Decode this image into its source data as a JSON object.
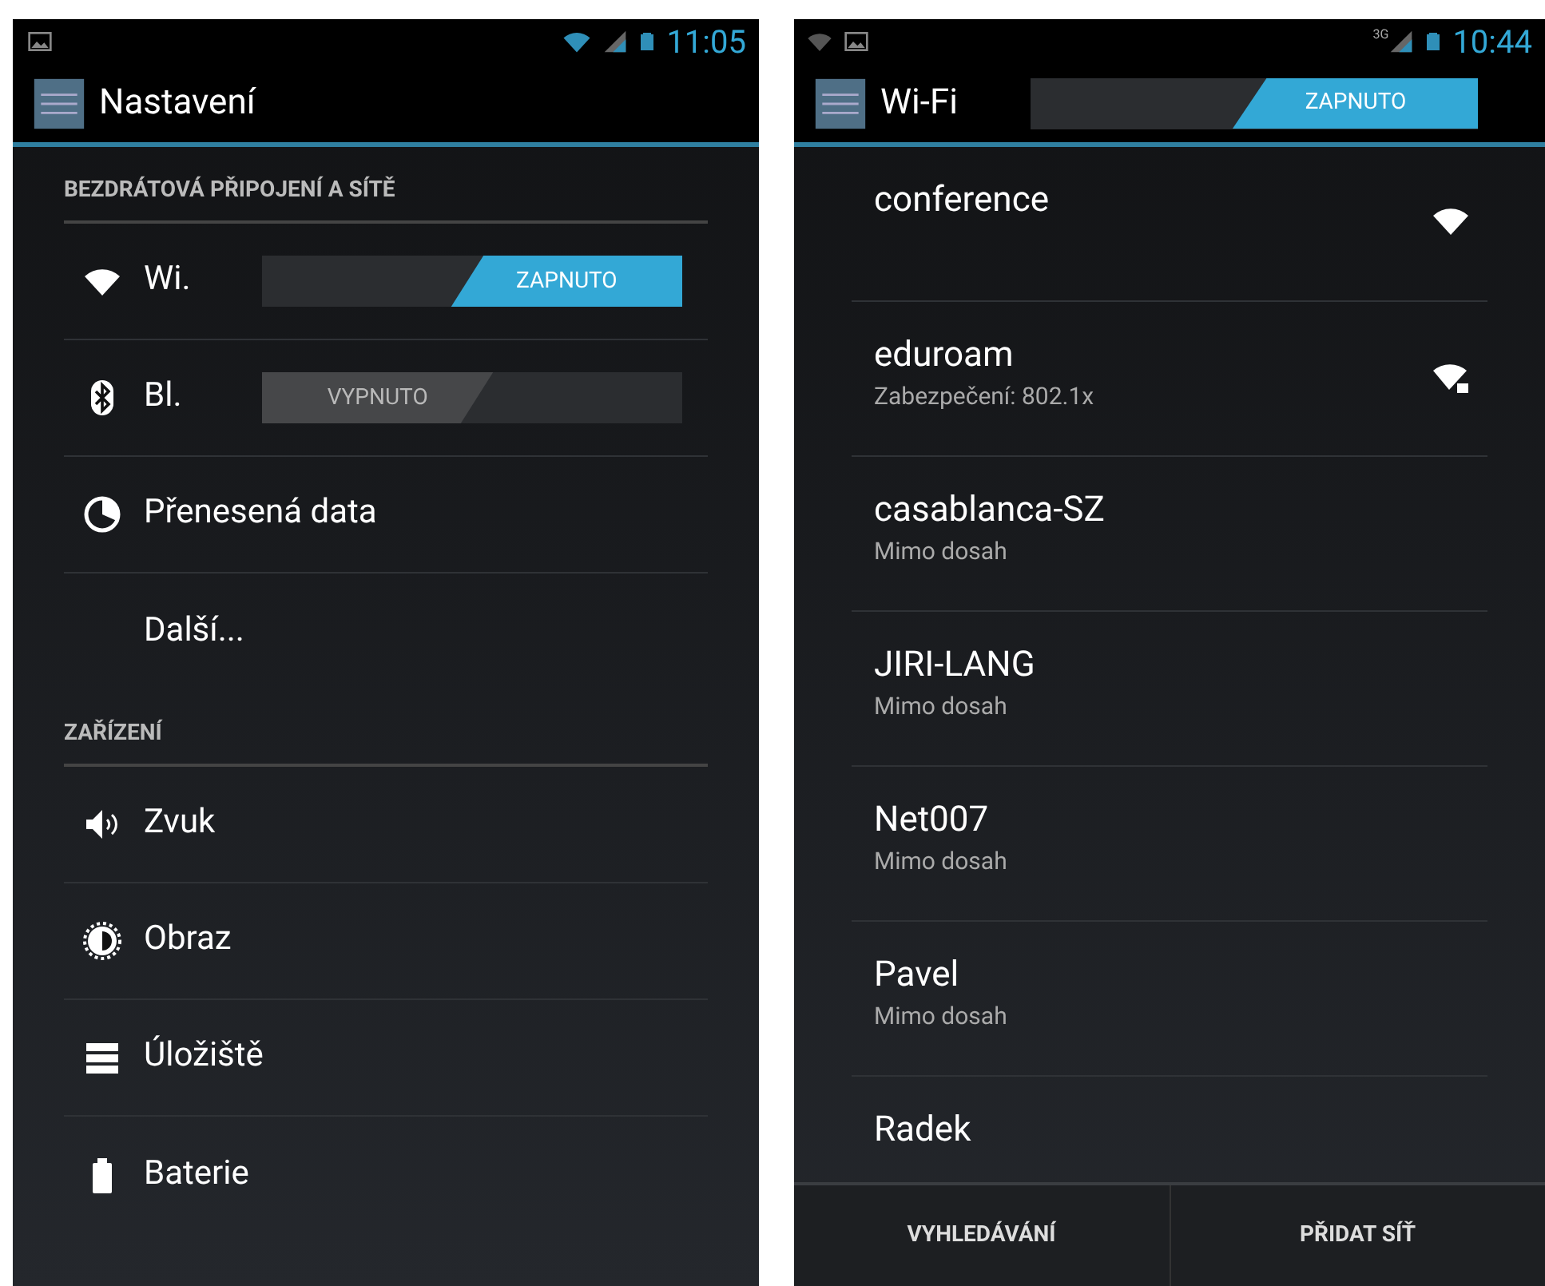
{
  "left_screen": {
    "status_bar": {
      "time": "11:05"
    },
    "action_bar": {
      "title": "Nastavení"
    },
    "sections": [
      {
        "header": "BEZDRÁTOVÁ PŘIPOJENÍ A SÍTĚ",
        "items": [
          {
            "kind": "wifi",
            "label": "Wi.",
            "toggle": {
              "on": true,
              "label": "ZAPNUTO"
            }
          },
          {
            "kind": "bluetooth",
            "label": "Bl.",
            "toggle": {
              "on": false,
              "label": "VYPNUTO"
            }
          },
          {
            "kind": "data",
            "label": "Přenesená data"
          },
          {
            "kind": "none",
            "label": "Další..."
          }
        ]
      },
      {
        "header": "ZAŘÍZENÍ",
        "items": [
          {
            "kind": "sound",
            "label": "Zvuk"
          },
          {
            "kind": "display",
            "label": "Obraz"
          },
          {
            "kind": "storage",
            "label": "Úložiště"
          },
          {
            "kind": "battery",
            "label": "Baterie"
          }
        ]
      }
    ]
  },
  "right_screen": {
    "status_bar": {
      "time": "10:44",
      "network": "3G"
    },
    "action_bar": {
      "title": "Wi-Fi",
      "toggle": {
        "on": true,
        "label": "ZAPNUTO"
      }
    },
    "networks": [
      {
        "name": "conference",
        "kind": "open"
      },
      {
        "name": "eduroam",
        "detail": "Zabezpečení: 802.1x",
        "kind": "secured"
      },
      {
        "name": "casablanca-SZ",
        "detail": "Mimo dosah"
      },
      {
        "name": "JIRI-LANG",
        "detail": "Mimo dosah"
      },
      {
        "name": "Net007",
        "detail": "Mimo dosah"
      },
      {
        "name": "Pavel",
        "detail": "Mimo dosah"
      },
      {
        "name": "Radek"
      }
    ],
    "bottom_buttons": [
      "VYHLEDÁVÁNÍ",
      "PŘIDAT SÍŤ"
    ]
  }
}
